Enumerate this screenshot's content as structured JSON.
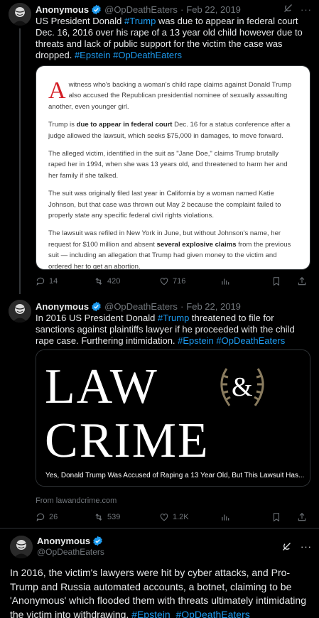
{
  "tweets": [
    {
      "author": "Anonymous",
      "handle": "@OpDeathEaters",
      "date": "Feb 22, 2019",
      "text_parts": [
        "US President Donald ",
        "#Trump",
        " was due to appear in federal court Dec. 16, 2016 over his rape of a 13 year old child however due to threats and lack of public support for the victim the case was dropped. ",
        "#Epstein",
        " ",
        "#OpDeathEaters"
      ],
      "article": {
        "dropcap": "A",
        "p1": "witness who's backing a woman's child rape claims against Donald Trump also accused the Republican presidential nominee of sexually assaulting another, even younger girl.",
        "p2_a": "Trump is ",
        "p2_bold": "due to appear in federal court",
        "p2_b": " Dec. 16 for a status conference after a judge allowed the lawsuit, which seeks $75,000 in damages, to move forward.",
        "p3": "The alleged victim, identified in the suit as \"Jane Doe,\" claims Trump brutally raped her in 1994, when she was 13 years old, and threatened to harm her and her family if she talked.",
        "p4": "The suit was originally filed last year in California by a woman named Katie Johnson, but that case was thrown out May 2 because the complaint failed to properly state any specific federal civil rights violations.",
        "p5_a": "The lawsuit was refiled in New York in June, but without Johnson's name, her request for $100 million and absent ",
        "p5_bold": "several explosive claims",
        "p5_b": " from the previous suit — including an allegation that Trump had given money to the victim and ordered her to get an abortion."
      },
      "replies": "14",
      "retweets": "420",
      "likes": "716"
    },
    {
      "author": "Anonymous",
      "handle": "@OpDeathEaters",
      "date": "Feb 22, 2019",
      "text_parts": [
        "In 2016 US President Donald ",
        "#Trump",
        " threatened to file for sanctions against plaintiffs lawyer if he proceeded with the child rape case. Furthering intimidation. ",
        "#Epstein",
        " ",
        "#OpDeathEaters"
      ],
      "card": {
        "logo_line1": "LAW",
        "logo_amp": "&",
        "logo_line2": "CRIME",
        "caption": "Yes, Donald Trump Was Accused of Raping a 13 Year Old, But This Lawsuit Has...",
        "source": "From lawandcrime.com"
      },
      "replies": "26",
      "retweets": "539",
      "likes": "1.2K"
    },
    {
      "author": "Anonymous",
      "handle": "@OpDeathEaters",
      "text_parts": [
        "In 2016, the victim's lawyers were hit by cyber attacks, and Pro-Trump and Russia automated accounts, a botnet, claiming to be 'Anonymous' which flooded them with threats ultimately intimidating the victim into withdrawing. ",
        "#Epstein",
        "  ",
        "#OpDeathEaters"
      ]
    }
  ],
  "colors": {
    "accent": "#1d9bf0",
    "muted": "#71767b",
    "dropcap": "#d41f26",
    "laurel": "#8a7c5f"
  }
}
